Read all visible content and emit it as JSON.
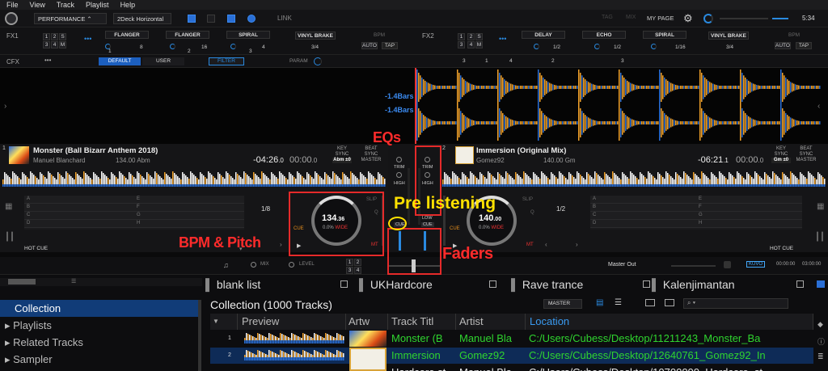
{
  "menu": [
    "File",
    "View",
    "Track",
    "Playlist",
    "Help"
  ],
  "topbar": {
    "mode": "PERFORMANCE",
    "layout": "2Deck Horizontal",
    "link": "LINK",
    "my_page": "MY PAGE",
    "time": "5:34",
    "gray1": "TAG",
    "gray2": "MIX"
  },
  "fx1": {
    "label": "FX1",
    "nums": [
      "1",
      "2",
      "S",
      "3",
      "4",
      "M"
    ],
    "effects": [
      "FLANGER",
      "FLANGER",
      "SPIRAL"
    ],
    "values": [
      "8",
      "16",
      "4"
    ],
    "brake": "VINYL BRAKE",
    "brake_val": "3/4",
    "bpm": "BPM",
    "auto": "AUTO",
    "tap": "TAP",
    "lane": [
      "1",
      "2",
      "3"
    ]
  },
  "fx2": {
    "label": "FX2",
    "nums": [
      "1",
      "2",
      "S",
      "3",
      "4",
      "M"
    ],
    "effects": [
      "DELAY",
      "ECHO",
      "SPIRAL"
    ],
    "values": [
      "1/2",
      "1/2",
      "1/16"
    ],
    "brake": "VINYL BRAKE",
    "brake_val": "3/4",
    "bpm": "BPM",
    "auto": "AUTO",
    "tap": "TAP",
    "lane": [
      "1",
      "2",
      "3"
    ]
  },
  "cfx": {
    "label": "CFX",
    "default": "DEFAULT",
    "user": "USER",
    "filter": "FILTER",
    "param": "PARAM",
    "nums": [
      "3",
      "4"
    ]
  },
  "wave": {
    "bars1": "-1.4Bars",
    "bars2": "-1.4Bars"
  },
  "deck1": {
    "num": "1",
    "title": "Monster (Ball Bizarr Anthem 2018)",
    "artist": "Manuel Blanchard",
    "info": "134.00 Abm",
    "remain": "-04:26",
    "remain_dec": ".0",
    "elapsed": "00:00",
    "elapsed_dec": ".0",
    "key": "KEY",
    "sync": "SYNC",
    "key_val": "Abm ±0",
    "beat": "BEAT",
    "sync2": "SYNC",
    "master": "MASTER",
    "bpm": "134",
    "bpm_dec": ".36",
    "pitch": "0.0%",
    "wide": "WIDE",
    "loop": "1/8",
    "cue": "CUE",
    "hot_cue": "HOT CUE",
    "slip": "SLIP",
    "q": "Q",
    "mt": "MT",
    "pads": [
      "A",
      "B",
      "C",
      "D",
      "E",
      "F",
      "G",
      "H"
    ]
  },
  "deck2": {
    "num": "2",
    "title": "Immersion (Original Mix)",
    "artist": "Gomez92",
    "info": "140.00 Gm",
    "remain": "-06:21",
    "remain_dec": ".1",
    "elapsed": "00:00",
    "elapsed_dec": ".0",
    "key": "KEY",
    "sync": "SYNC",
    "key_val": "Gm ±0",
    "beat": "BEAT",
    "sync2": "SYNC",
    "master": "MASTER",
    "bpm": "140",
    "bpm_dec": ".00",
    "pitch": "0.0%",
    "wide": "WIDE",
    "loop": "1/2",
    "cue": "CUE",
    "hot_cue": "HOT CUE",
    "slip": "SLIP",
    "q": "Q",
    "mt": "MT",
    "pads": [
      "A",
      "B",
      "C",
      "D",
      "E",
      "F",
      "G",
      "H"
    ]
  },
  "mixer": {
    "trim": "TRIM",
    "high": "HIGH",
    "mid": "MID",
    "low": "LOW",
    "cue": "CUE",
    "mix": "MIX",
    "level": "LEVEL",
    "master_out": "Master Out",
    "rec_time": "00:00:00",
    "total_time": "03:00:00",
    "kuvo": "KUVO",
    "ch": [
      "1",
      "2",
      "3",
      "4"
    ]
  },
  "annotations": {
    "eqs": "EQs",
    "pre": "Pre listening",
    "bpm_pitch": "BPM & Pitch",
    "faders": "Faders"
  },
  "browser": {
    "tabs": [
      "blank list",
      "UKHardcore",
      "Rave trance",
      "Kalenjimantan"
    ],
    "sidebar": [
      "Collection",
      "Playlists",
      "Related Tracks",
      "Sampler"
    ],
    "collection_title": "Collection (1000 Tracks)",
    "master": "MASTER",
    "columns": [
      "Preview",
      "Artw",
      "Track Titl",
      "Artist",
      "Location"
    ],
    "rows": [
      {
        "idx": "1",
        "title": "Monster (B",
        "artist": "Manuel Bla",
        "location": "C:/Users/Cubess/Desktop/11211243_Monster_Ba",
        "color": "#2fd42f"
      },
      {
        "idx": "2",
        "title": "Immersion",
        "artist": "Gomez92",
        "location": "C:/Users/Cubess/Desktop/12640761_Gomez92_In",
        "color": "#2fd42f"
      },
      {
        "idx": "",
        "title": "Hardcore st",
        "artist": "Manuel Bla",
        "location": "C:/Users/Cubess/Desktop/10700000_Hardcore_st",
        "color": "#e8e8e8"
      }
    ]
  },
  "colors": {
    "accent": "#2a8ae0",
    "annotation_red": "#e52a2a",
    "annotation_yellow": "#ffe100",
    "row_green": "#2fd42f",
    "selected_row": "#0e2b57"
  }
}
